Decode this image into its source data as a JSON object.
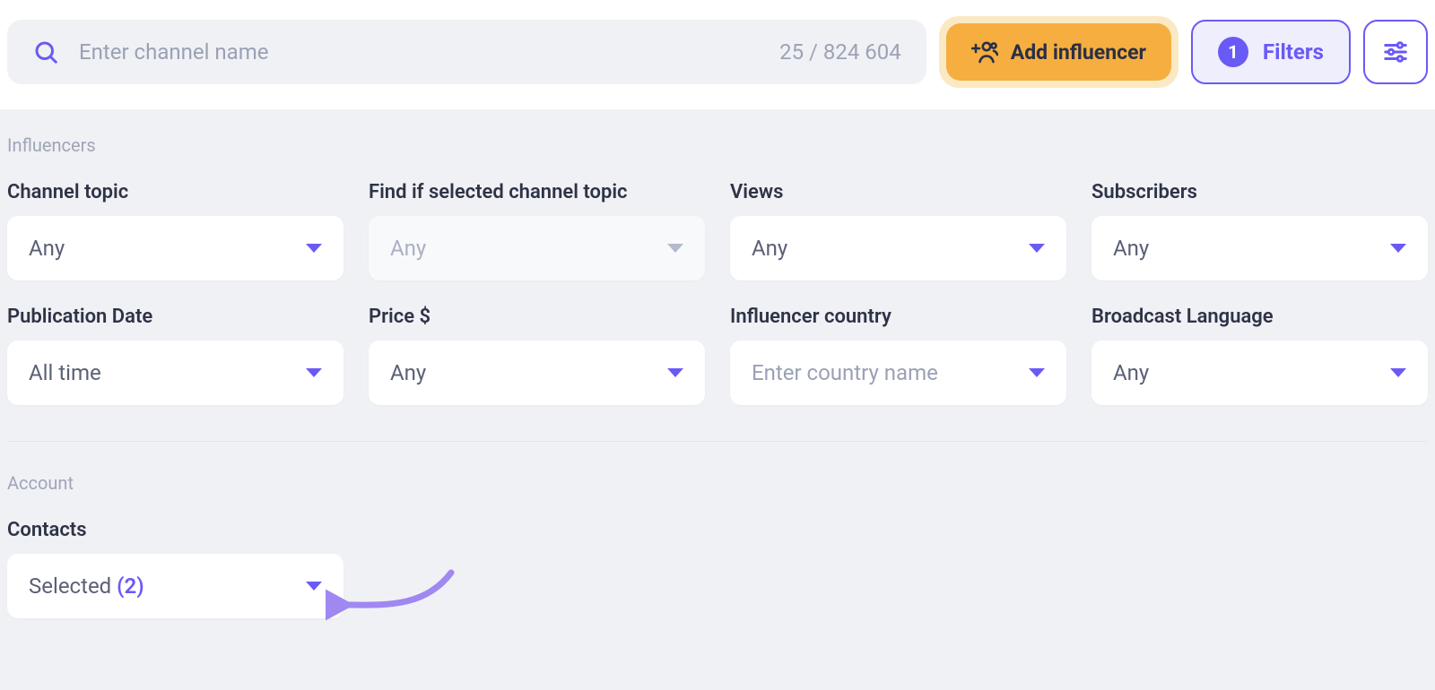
{
  "search": {
    "placeholder": "Enter channel name",
    "count_text": "25 / 824 604"
  },
  "buttons": {
    "add_influencer": "Add influencer",
    "filters": "Filters",
    "filters_count": "1"
  },
  "sections": {
    "influencers": "Influencers",
    "account": "Account"
  },
  "filters": {
    "channel_topic": {
      "label": "Channel topic",
      "value": "Any"
    },
    "find_if_topic": {
      "label": "Find if selected channel topic",
      "value": "Any"
    },
    "views": {
      "label": "Views",
      "value": "Any"
    },
    "subscribers": {
      "label": "Subscribers",
      "value": "Any"
    },
    "publication_date": {
      "label": "Publication Date",
      "value": "All time"
    },
    "price": {
      "label": "Price $",
      "value": "Any"
    },
    "influencer_country": {
      "label": "Influencer country",
      "placeholder": "Enter country name"
    },
    "broadcast_language": {
      "label": "Broadcast Language",
      "value": "Any"
    }
  },
  "account": {
    "contacts": {
      "label": "Contacts",
      "value_prefix": "Selected",
      "count": "(2)"
    }
  }
}
